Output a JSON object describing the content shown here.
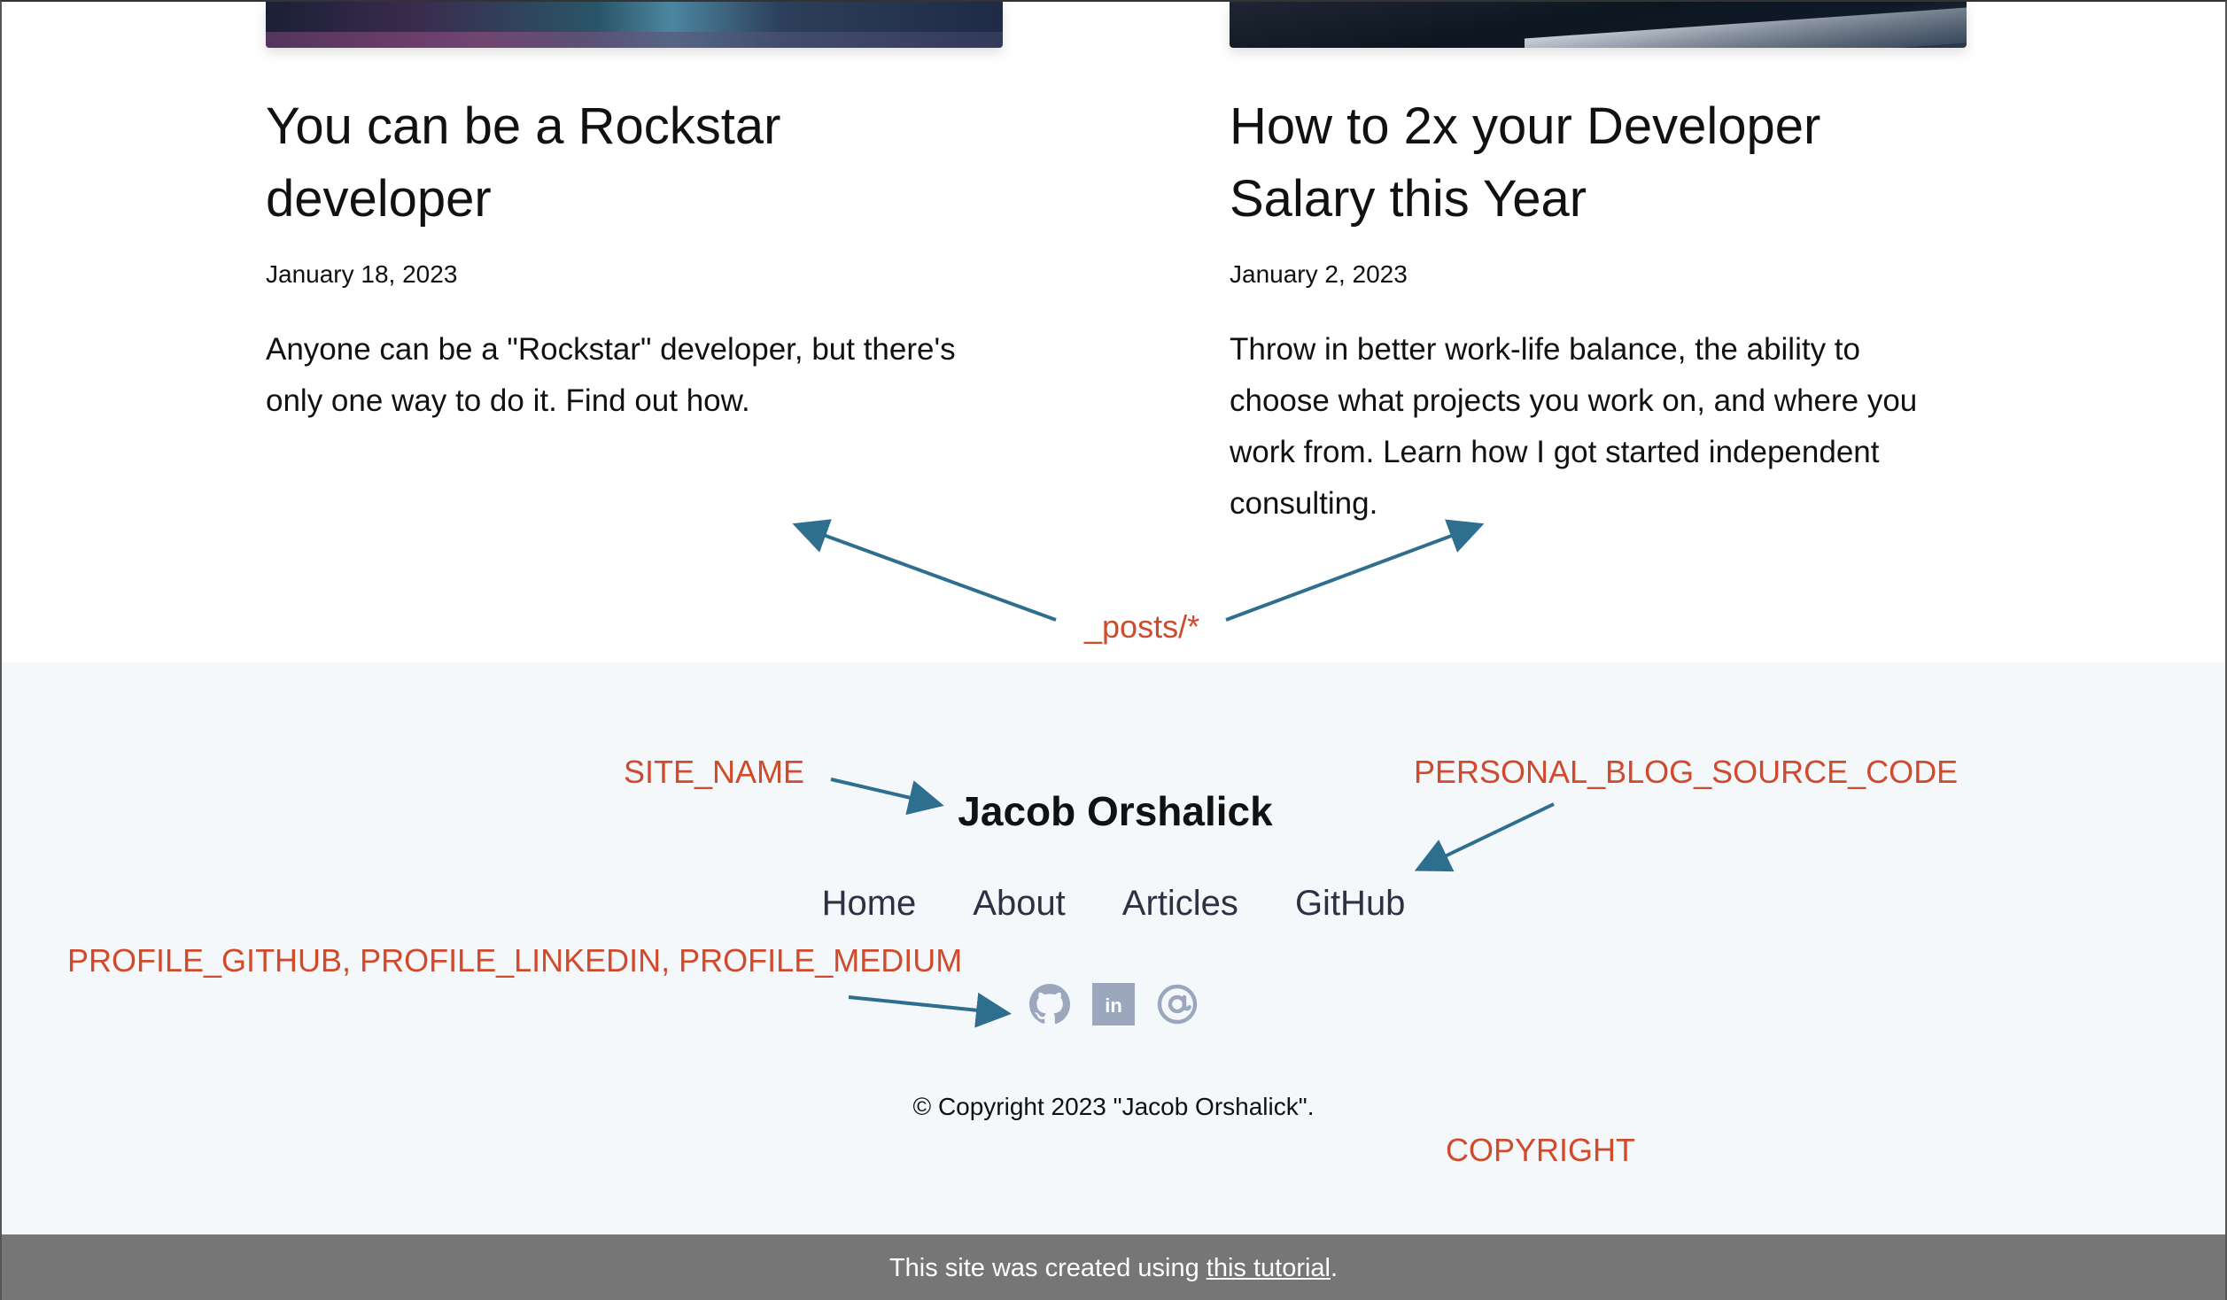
{
  "posts": [
    {
      "title": "You can be a Rockstar developer",
      "date": "January 18, 2023",
      "excerpt": "Anyone can be a \"Rockstar\" developer, but there's only one way to do it. Find out how."
    },
    {
      "title": "How to 2x your Developer Salary this Year",
      "date": "January 2, 2023",
      "excerpt": "Throw in better work-life balance, the ability to choose what projects you work on, and where you work from. Learn how I got started independent consulting."
    }
  ],
  "annotations": {
    "posts": "_posts/*",
    "site_name": "SITE_NAME",
    "source_code": "PERSONAL_BLOG_SOURCE_CODE",
    "profiles": "PROFILE_GITHUB, PROFILE_LINKEDIN, PROFILE_MEDIUM",
    "copyright": "COPYRIGHT",
    "color": "#d04a2c",
    "arrow_color": "#2e6e8e"
  },
  "footer": {
    "site_name": "Jacob Orshalick",
    "nav": [
      "Home",
      "About",
      "Articles",
      "GitHub"
    ],
    "social_icons": [
      "github-icon",
      "linkedin-icon",
      "medium-at-icon"
    ],
    "copyright": "© Copyright 2023 \"Jacob Orshalick\".",
    "background": "#f4f8fb"
  },
  "bottom_bar": {
    "prefix": "This site was created using ",
    "link": "this tutorial",
    "suffix": ".",
    "background": "#767676"
  }
}
